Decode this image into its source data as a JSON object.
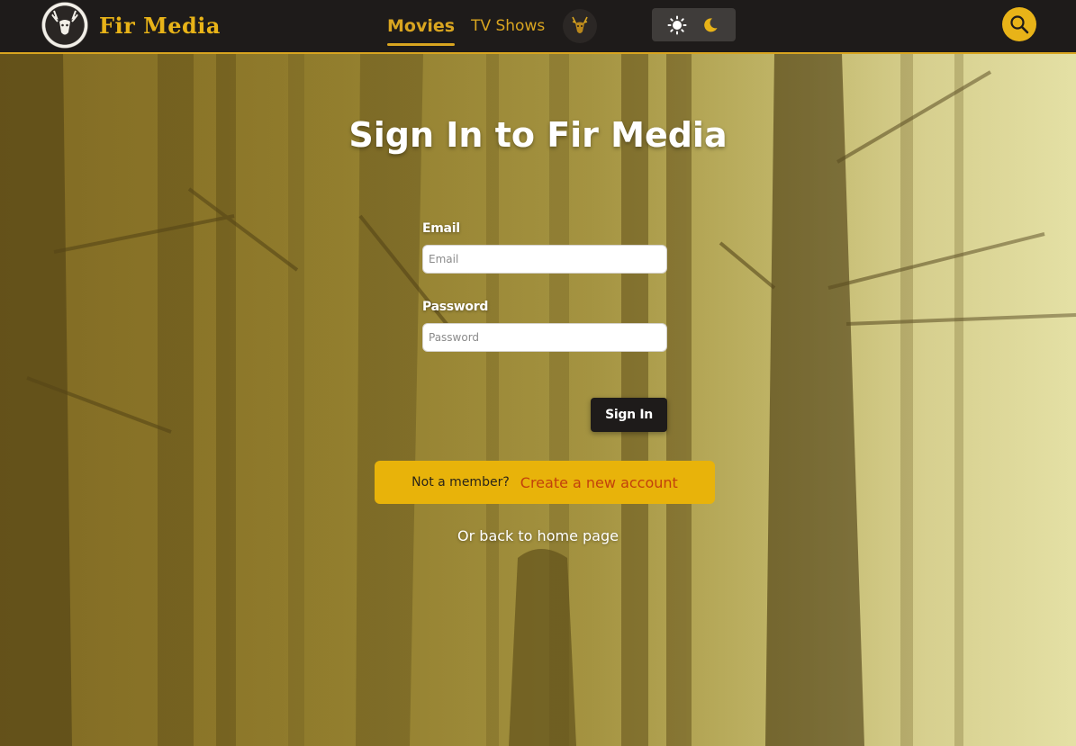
{
  "brand": {
    "name": "Fir Media",
    "logo_icon": "deer-head-logo-icon"
  },
  "nav": {
    "items": [
      {
        "label": "Movies",
        "active": true
      },
      {
        "label": "TV Shows",
        "active": false
      }
    ],
    "avatar_icon": "deer-avatar-icon"
  },
  "theme_toggle": {
    "light_icon": "sun-icon",
    "dark_icon": "moon-icon"
  },
  "search": {
    "icon": "search-icon"
  },
  "form": {
    "title": "Sign In to Fir Media",
    "email_label": "Email",
    "email_placeholder": "Email",
    "email_value": "",
    "password_label": "Password",
    "password_placeholder": "Password",
    "password_value": "",
    "submit_label": "Sign In"
  },
  "signup": {
    "prompt": "Not a member?",
    "link_label": "Create a new account"
  },
  "home_link": {
    "label": "Or back to home page"
  },
  "colors": {
    "nav_bg": "#1e1b1a",
    "accent": "#e8b318",
    "link": "#c2410c",
    "button_dark": "#1e1b1a"
  }
}
